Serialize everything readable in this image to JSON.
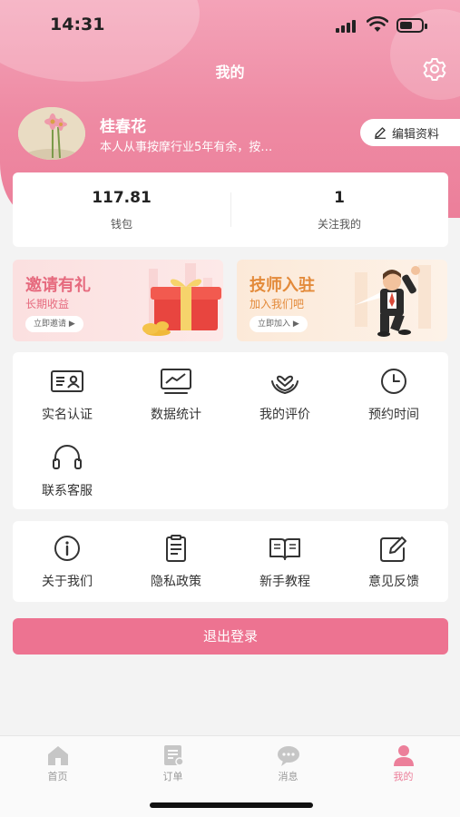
{
  "status_bar": {
    "time": "14:31"
  },
  "nav": {
    "title": "我的",
    "settings_icon": "gear-icon"
  },
  "profile": {
    "name": "桂春花",
    "bio": "本人从事按摩行业5年有余，按…",
    "edit_label": "编辑资料"
  },
  "stats": [
    {
      "value": "117.81",
      "label": "钱包"
    },
    {
      "value": "1",
      "label": "关注我的"
    }
  ],
  "banners": {
    "invite": {
      "title": "邀请有礼",
      "subtitle": "长期收益",
      "button": "立即邀请 ▶"
    },
    "join": {
      "title": "技师入驻",
      "subtitle": "加入我们吧",
      "button": "立即加入 ▶"
    }
  },
  "grid_primary": [
    {
      "label": "实名认证",
      "icon": "id-card-icon"
    },
    {
      "label": "数据统计",
      "icon": "chart-monitor-icon"
    },
    {
      "label": "我的评价",
      "icon": "heart-hands-icon"
    },
    {
      "label": "预约时间",
      "icon": "clock-icon"
    },
    {
      "label": "联系客服",
      "icon": "headset-icon"
    }
  ],
  "grid_secondary": [
    {
      "label": "关于我们",
      "icon": "info-icon"
    },
    {
      "label": "隐私政策",
      "icon": "document-icon"
    },
    {
      "label": "新手教程",
      "icon": "book-icon"
    },
    {
      "label": "意见反馈",
      "icon": "edit-icon"
    }
  ],
  "logout_label": "退出登录",
  "tabs": [
    {
      "label": "首页",
      "icon": "home-icon",
      "active": false
    },
    {
      "label": "订单",
      "icon": "order-icon",
      "active": false
    },
    {
      "label": "消息",
      "icon": "message-icon",
      "active": false
    },
    {
      "label": "我的",
      "icon": "user-icon",
      "active": true
    }
  ],
  "colors": {
    "accent": "#ec7f9a",
    "logout_button": "#ed7391",
    "invite_title": "#e66a7e",
    "join_title": "#e38a3a"
  }
}
